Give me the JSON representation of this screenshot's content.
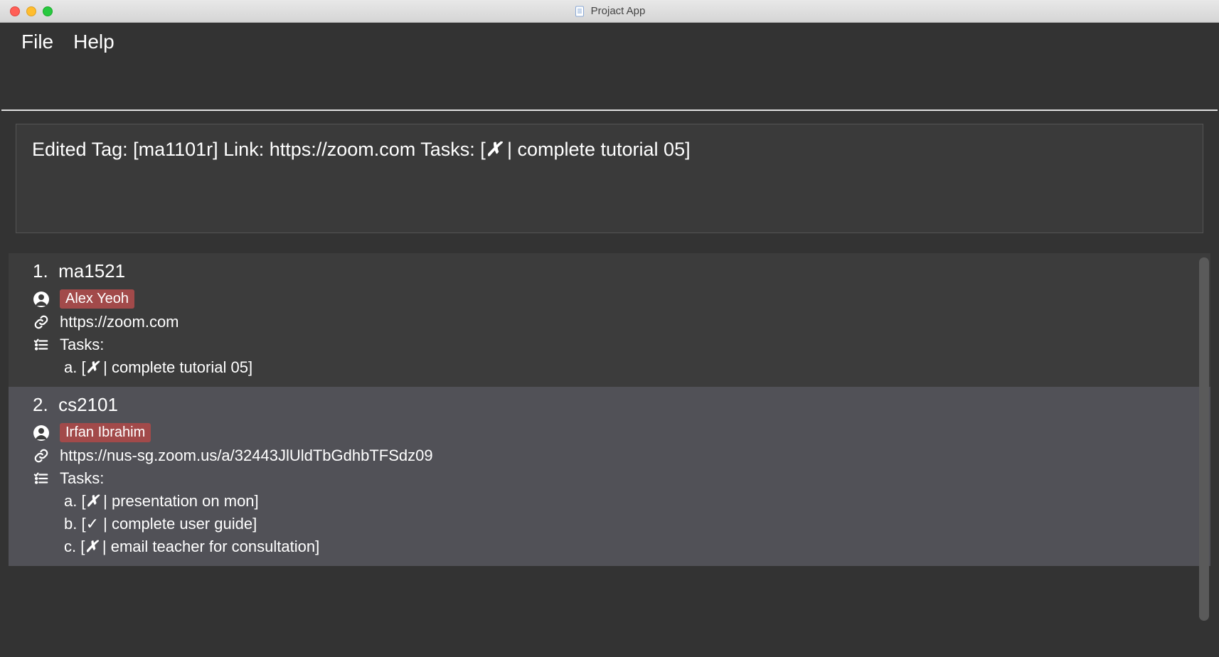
{
  "window": {
    "title": "Projact App"
  },
  "menu": {
    "file": "File",
    "help": "Help"
  },
  "message": {
    "prefix": "Edited Tag: [ma1101r] Link: https://zoom.com Tasks: [",
    "x": "✗",
    "suffix": " | complete tutorial 05]"
  },
  "items": [
    {
      "index": "1.",
      "title": "ma1521",
      "person": "Alex Yeoh",
      "link": "https://zoom.com",
      "tasks_label": "Tasks:",
      "selected": false,
      "tasks": [
        {
          "letter": "a.",
          "done": false,
          "text": "complete tutorial 05"
        }
      ]
    },
    {
      "index": "2.",
      "title": "cs2101",
      "person": "Irfan Ibrahim",
      "link": "https://nus-sg.zoom.us/a/32443JlUldTbGdhbTFSdz09",
      "tasks_label": "Tasks:",
      "selected": true,
      "tasks": [
        {
          "letter": "a.",
          "done": false,
          "text": "presentation on mon"
        },
        {
          "letter": "b.",
          "done": true,
          "text": "complete user guide"
        },
        {
          "letter": "c.",
          "done": false,
          "text": "email teacher for consultation"
        }
      ]
    }
  ]
}
